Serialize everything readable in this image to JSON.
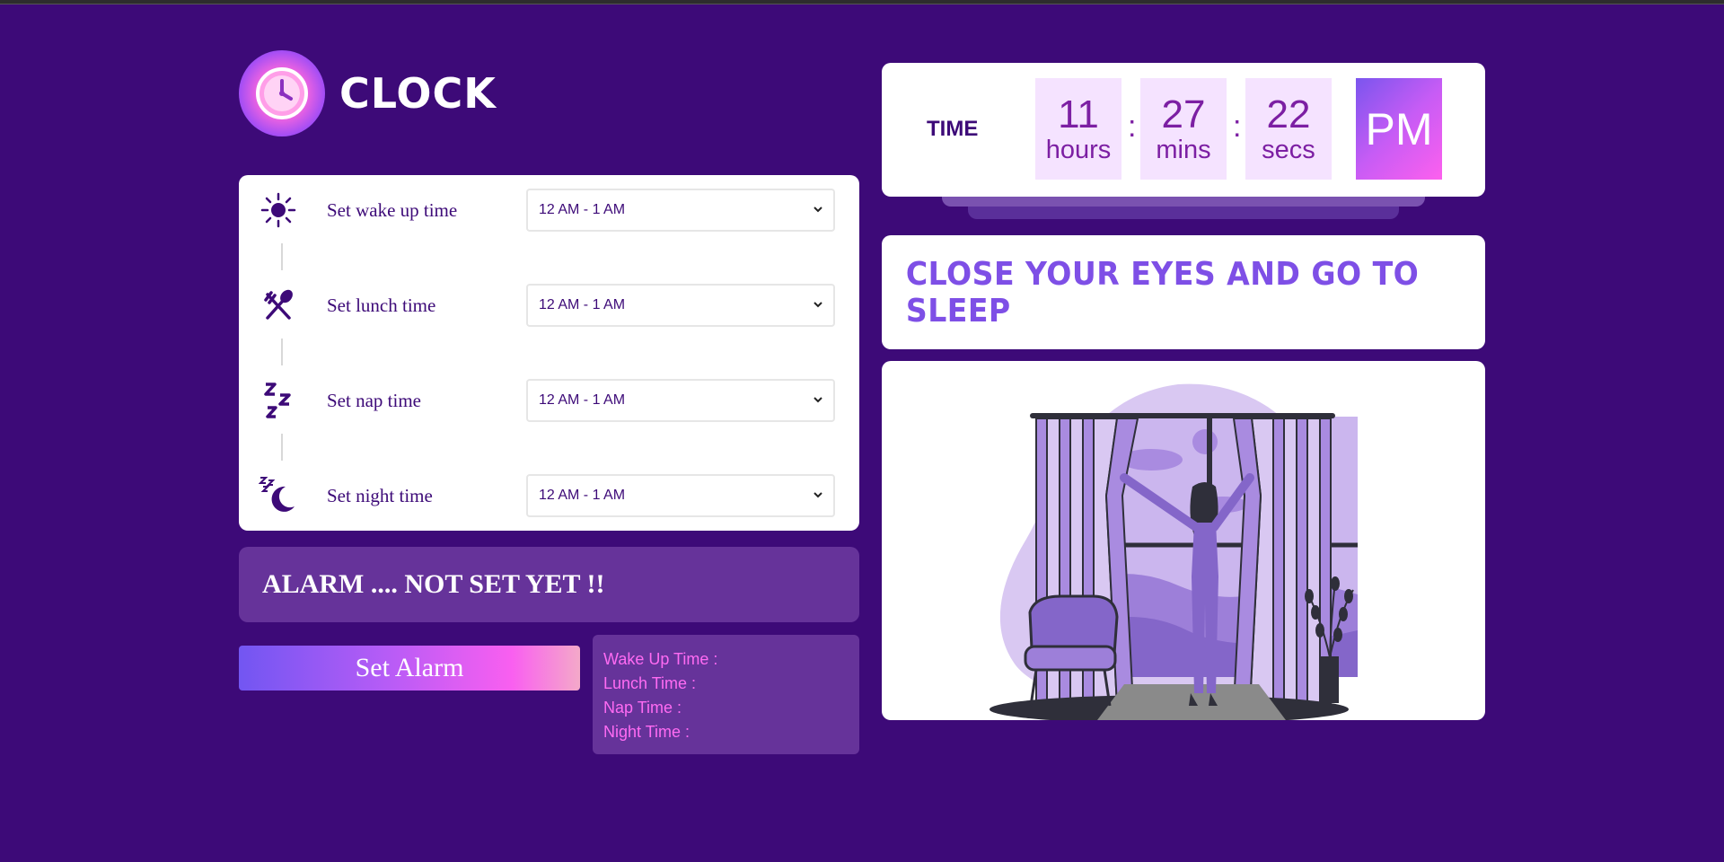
{
  "app": {
    "logo_text": "CLOCK"
  },
  "schedule": {
    "rows": [
      {
        "icon": "sun-icon",
        "label": "Set wake up time",
        "value": "12 AM - 1 AM"
      },
      {
        "icon": "fork-spoon-icon",
        "label": "Set lunch time",
        "value": "12 AM - 1 AM"
      },
      {
        "icon": "zzz-icon",
        "label": "Set nap time",
        "value": "12 AM - 1 AM"
      },
      {
        "icon": "moon-icon",
        "label": "Set night time",
        "value": "12 AM - 1 AM"
      }
    ]
  },
  "alarm": {
    "status_text": "ALARM .... NOT SET YET !!",
    "button_label": "Set Alarm"
  },
  "summary": {
    "wake": "Wake Up Time :",
    "lunch": "Lunch Time :",
    "nap": "Nap Time :",
    "night": "Night Time :"
  },
  "clock": {
    "label": "TIME",
    "hours": "11",
    "hours_unit": "hours",
    "mins": "27",
    "mins_unit": "mins",
    "secs": "22",
    "secs_unit": "secs",
    "separator": ":",
    "ampm": "PM"
  },
  "message": {
    "text": "CLOSE YOUR EYES AND GO TO SLEEP"
  },
  "colors": {
    "background": "#3d0a78",
    "accent": "#7e4fe6",
    "pink": "#ff6bf3",
    "card": "#ffffff",
    "panel": "#66339a"
  }
}
